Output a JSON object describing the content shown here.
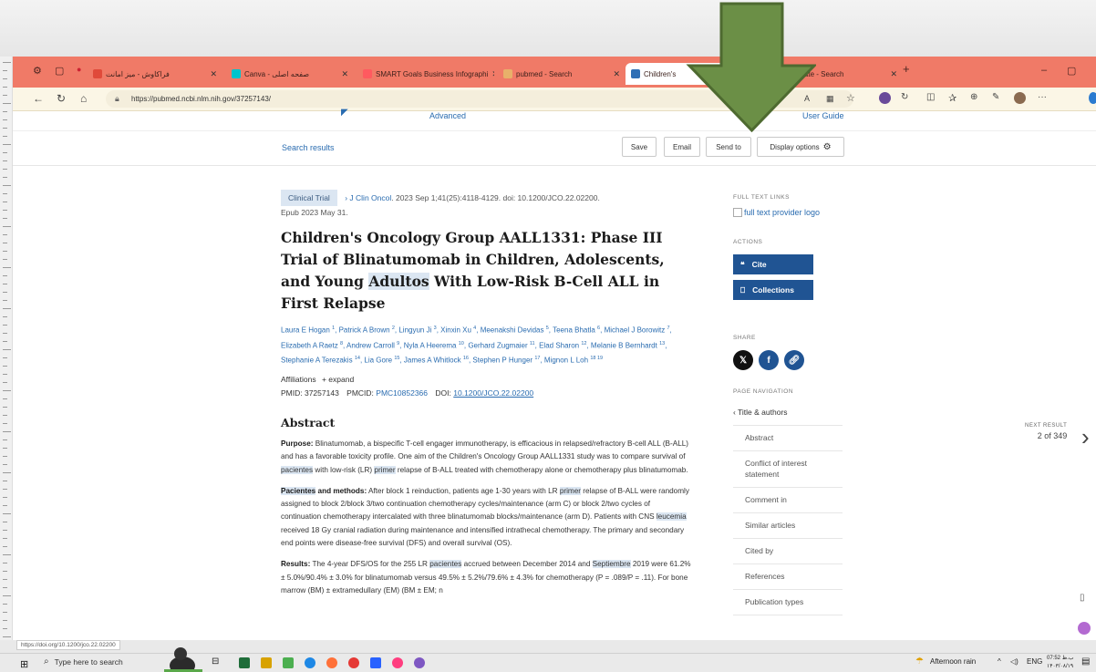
{
  "browser": {
    "tabs": [
      {
        "label": "فراکاوش - میز امانت",
        "fav": "#e04a3a"
      },
      {
        "label": "Canva - صفحه اصلی",
        "fav": "#00c4cc"
      },
      {
        "label": "SMART Goals Business Infographi",
        "fav": "#ff5a5f"
      },
      {
        "label": "pubmed - Search",
        "fav": "#e8b06a"
      },
      {
        "label": "Children's",
        "fav": "#2f6fb5"
      },
      {
        "label": "Translate - Search",
        "fav": "#e8b06a"
      }
    ],
    "new_tab": "+",
    "url": "https://pubmed.ncbi.nlm.nih.gov/37257143/"
  },
  "ncbi": {
    "advanced": "Advanced",
    "user_guide": "User Guide"
  },
  "actionbar": {
    "search_results": "Search results",
    "save": "Save",
    "email": "Email",
    "send_to": "Send to",
    "display_options": "Display options"
  },
  "article": {
    "badge": "Clinical Trial",
    "journal": "J Clin Oncol",
    "citation": ". 2023 Sep 1;41(25):4118-4129. doi: 10.1200/JCO.22.02200.",
    "epub": "Epub 2023 May 31.",
    "title_a": "Children's Oncology Group AALL1331: Phase III Trial of Blinatumomab in Children, Adolescents, and Young ",
    "title_hl": "Adultos",
    "title_b": " With Low-Risk B-Cell ALL in First Relapse",
    "authors": [
      {
        "name": "Laura E Hogan",
        "sup": "1"
      },
      {
        "name": "Patrick A Brown",
        "sup": "2"
      },
      {
        "name": "Lingyun Ji",
        "sup": "3"
      },
      {
        "name": "Xinxin Xu",
        "sup": "4"
      },
      {
        "name": "Meenakshi Devidas",
        "sup": "5"
      },
      {
        "name": "Teena Bhatla",
        "sup": "6"
      },
      {
        "name": "Michael J Borowitz",
        "sup": "7"
      },
      {
        "name": "Elizabeth A Raetz",
        "sup": "8"
      },
      {
        "name": "Andrew Carroll",
        "sup": "9"
      },
      {
        "name": "Nyla A Heerema",
        "sup": "10"
      },
      {
        "name": "Gerhard Zugmaier",
        "sup": "11"
      },
      {
        "name": "Elad Sharon",
        "sup": "12"
      },
      {
        "name": "Melanie B Bernhardt",
        "sup": "13"
      },
      {
        "name": "Stephanie A Terezakis",
        "sup": "14"
      },
      {
        "name": "Lia Gore",
        "sup": "15"
      },
      {
        "name": "James A Whitlock",
        "sup": "16"
      },
      {
        "name": "Stephen P Hunger",
        "sup": "17"
      },
      {
        "name": "Mignon L Loh",
        "sup": "18 19"
      }
    ],
    "affiliations": "Affiliations",
    "expand": "+ expand",
    "pmid_label": "PMID: 37257143",
    "pmcid_label": "PMCID:",
    "pmcid": "PMC10852366",
    "doi_label": "DOI:",
    "doi": "10.1200/JCO.22.02200",
    "abstract_heading": "Abstract",
    "purpose_label": "Purpose:",
    "purpose_1": " Blinatumomab, a bispecific T-cell engager immunotherapy, is efficacious in relapsed/refractory B-cell ALL (B-ALL) and has a favorable toxicity profile. One aim of the Children's Oncology Group AALL1331 study was to compare survival of ",
    "purpose_hl1": "pacientes",
    "purpose_2": " with low-risk (LR) ",
    "purpose_hl2": "primer",
    "purpose_3": " relapse of B-ALL treated with chemotherapy alone or chemotherapy plus blinatumomab.",
    "methods_label_hl": "Pacientes",
    "methods_label_rest": " and methods:",
    "methods_1": " After block 1 reinduction, patients age 1-30 years with LR ",
    "methods_hl1": "primer",
    "methods_2": " relapse of B-ALL were randomly assigned to block 2/block 3/two continuation chemotherapy cycles/maintenance (arm C) or block 2/two cycles of continuation chemotherapy intercalated with three blinatumomab blocks/maintenance (arm D). Patients with CNS ",
    "methods_hl2": "leucemia",
    "methods_3": " received 18 Gy cranial radiation during maintenance and intensified intrathecal chemotherapy. The primary and secondary end points were disease-free survival (DFS) and overall survival (OS).",
    "results_label": "Results:",
    "results_1": " The 4-year DFS/OS for the 255 LR ",
    "results_hl1": "pacientes",
    "results_2": " accrued between December 2014 and ",
    "results_hl2": "Septiembre",
    "results_3": " 2019 were 61.2% ± 5.0%/90.4% ± 3.0% for blinatumomab versus 49.5% ± 5.2%/79.6% ± 4.3% for chemotherapy (P = .089/P = .11). For bone marrow (BM) ± extramedullary (EM) (BM ± EM; n"
  },
  "sidebar": {
    "full_text_links": "FULL TEXT LINKS",
    "provider_logo": "full text provider logo",
    "actions": "ACTIONS",
    "cite": "Cite",
    "collections": "Collections",
    "share": "SHARE",
    "page_navigation": "PAGE NAVIGATION",
    "nav": [
      "Title & authors",
      "Abstract",
      "Conflict of interest statement",
      "Comment in",
      "Similar articles",
      "Cited by",
      "References",
      "Publication types"
    ]
  },
  "next_result": {
    "label": "NEXT RESULT",
    "count": "2 of 349"
  },
  "status_url": "https://doi.org/10.1200/jco.22.02200",
  "taskbar": {
    "search_placeholder": "Type here to search",
    "weather": "Afternoon rain",
    "lang": "ENG",
    "time": "07:52 ب.ظ",
    "date": "۱۴۰۳/۰۸/۱۹"
  },
  "colors": {
    "tabbar": "#f07a67",
    "arrow": "#6b8f46",
    "link": "#2a6cb0",
    "pubmed_button": "#205493"
  }
}
